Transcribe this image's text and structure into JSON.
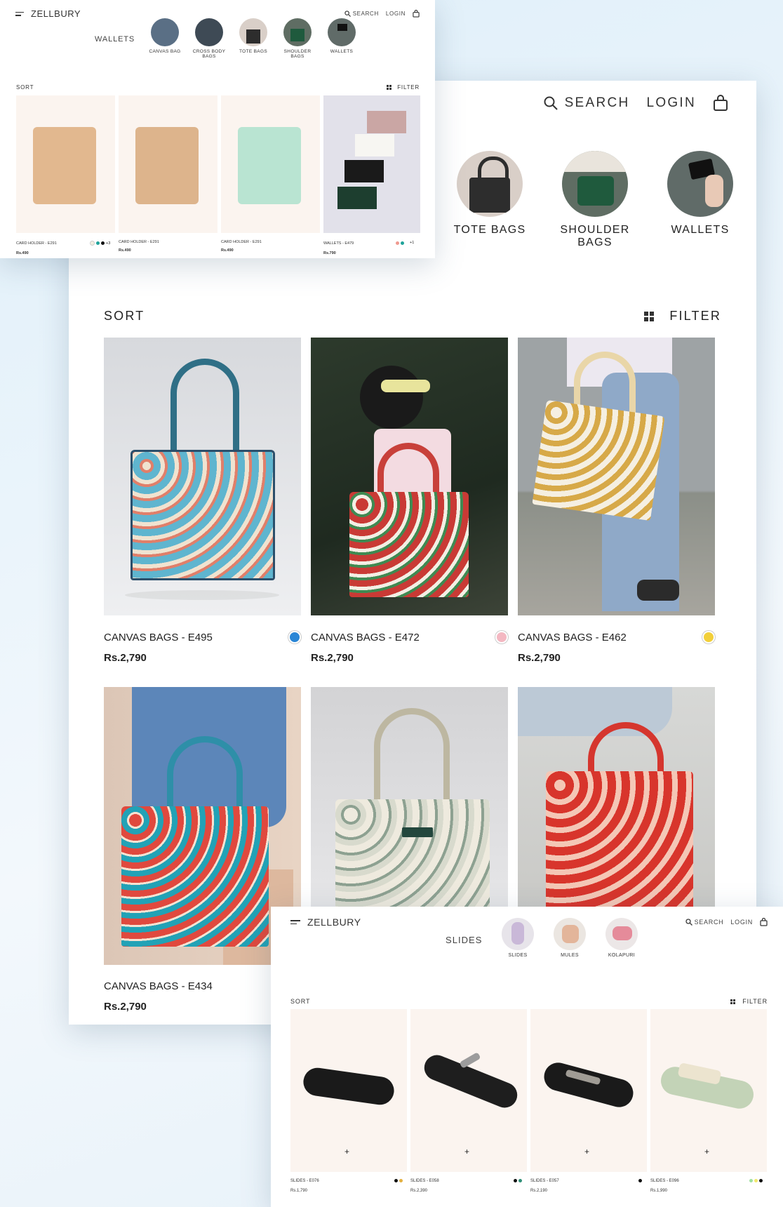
{
  "main": {
    "nav": {
      "search": "SEARCH",
      "login": "LOGIN"
    },
    "categories": [
      {
        "label": "TOTE BAGS"
      },
      {
        "label": "SHOULDER BAGS"
      },
      {
        "label": "WALLETS"
      }
    ],
    "sort": "SORT",
    "filter": "FILTER",
    "products": [
      {
        "name": "CANVAS BAGS - E495",
        "price": "Rs.2,790",
        "swatch": "#2a86d6"
      },
      {
        "name": "CANVAS BAGS - E472",
        "price": "Rs.2,790",
        "swatch": "#f4b8c2"
      },
      {
        "name": "CANVAS BAGS - E462",
        "price": "Rs.2,790",
        "swatch": "#f2cf3a"
      },
      {
        "name": "CANVAS BAGS - E434",
        "price": "Rs.2,790",
        "swatch": ""
      }
    ]
  },
  "wallets_page": {
    "brand": "ZELLBURY",
    "search": "SEARCH",
    "login": "LOGIN",
    "current": "WALLETS",
    "categories": [
      "CANVAS BAG",
      "CROSS BODY BAGS",
      "TOTE BAGS",
      "SHOULDER BAGS",
      "WALLETS"
    ],
    "sort": "SORT",
    "filter": "FILTER",
    "products": [
      {
        "name": "CARD HOLDER - E291",
        "price": "Rs.490",
        "more": "+3"
      },
      {
        "name": "CARD HOLDER - E291",
        "price": "Rs.490",
        "more": ""
      },
      {
        "name": "CARD HOLDER - E291",
        "price": "Rs.490",
        "more": ""
      },
      {
        "name": "WALLETS - E479",
        "price": "Rs.790",
        "more": "+1"
      }
    ]
  },
  "slides_page": {
    "brand": "ZELLBURY",
    "search": "SEARCH",
    "login": "LOGIN",
    "current": "SLIDES",
    "categories": [
      "SLIDES",
      "MULES",
      "KOLAPURI"
    ],
    "sort": "SORT",
    "filter": "FILTER",
    "plus": "+",
    "products": [
      {
        "name": "SLIDES - E076",
        "price": "Rs.1,790"
      },
      {
        "name": "SLIDES - E058",
        "price": "Rs.2,390"
      },
      {
        "name": "SLIDES - E057",
        "price": "Rs.2,190"
      },
      {
        "name": "SLIDES - E096",
        "price": "Rs.1,990"
      }
    ]
  },
  "colors": {
    "accent": "#222222",
    "tile_bg": "#fbf4ef"
  }
}
